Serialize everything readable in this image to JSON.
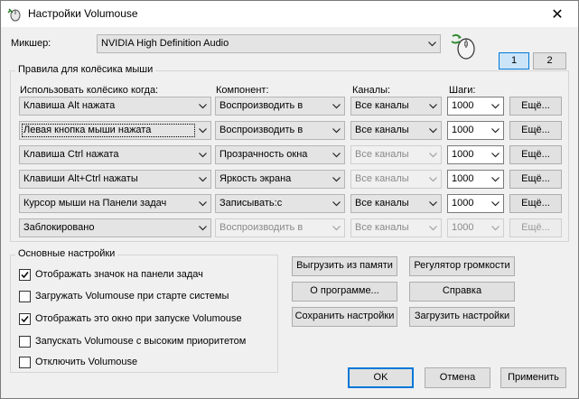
{
  "window": {
    "title": "Настройки Volumouse",
    "close_glyph": "✕"
  },
  "mixer": {
    "label": "Микшер:",
    "value": "NVIDIA High Definition Audio",
    "tabs": [
      "1",
      "2"
    ]
  },
  "wheel_rules": {
    "title": "Правила для колёсика мыши",
    "col_use_when": "Использовать колёсико когда:",
    "col_component": "Компонент:",
    "col_channels": "Каналы:",
    "col_steps": "Шаги:",
    "more_label": "Ещё...",
    "rows": [
      {
        "condition": "Клавиша Alt нажата",
        "component": "Воспроизводить в",
        "channels": "Все каналы",
        "steps": "1000"
      },
      {
        "condition": "Левая кнопка мыши нажата",
        "component": "Воспроизводить в",
        "channels": "Все каналы",
        "steps": "1000"
      },
      {
        "condition": "Клавиша Ctrl нажата",
        "component": "Прозрачность окна",
        "channels": "Все каналы",
        "steps": "1000"
      },
      {
        "condition": "Клавиши Alt+Ctrl нажаты",
        "component": "Яркость экрана",
        "channels": "Все каналы",
        "steps": "1000"
      },
      {
        "condition": "Курсор мыши на Панели задач",
        "component": "Записывать:с",
        "channels": "Все каналы",
        "steps": "1000"
      },
      {
        "condition": "Заблокировано",
        "component": "Воспроизводить в",
        "channels": "Все каналы",
        "steps": "1000"
      }
    ]
  },
  "basic": {
    "title": "Основные настройки",
    "options": [
      {
        "label": "Отображать значок на панели задач",
        "checked": true
      },
      {
        "label": "Загружать Volumouse при старте системы",
        "checked": false
      },
      {
        "label": "Отображать это окно при запуске Volumouse",
        "checked": true
      },
      {
        "label": "Запускать Volumouse с высоким приоритетом",
        "checked": false
      },
      {
        "label": "Отключить Volumouse",
        "checked": false
      }
    ]
  },
  "actions": {
    "unload": "Выгрузить из памяти",
    "volume_control": "Регулятор громкости",
    "about": "О программе...",
    "help": "Справка",
    "save_settings": "Сохранить настройки",
    "load_settings": "Загрузить настройки"
  },
  "footer": {
    "ok": "OK",
    "cancel": "Отмена",
    "apply": "Применить"
  },
  "colors": {
    "accent": "#0078d7",
    "window_bg": "#f0f0f0"
  }
}
